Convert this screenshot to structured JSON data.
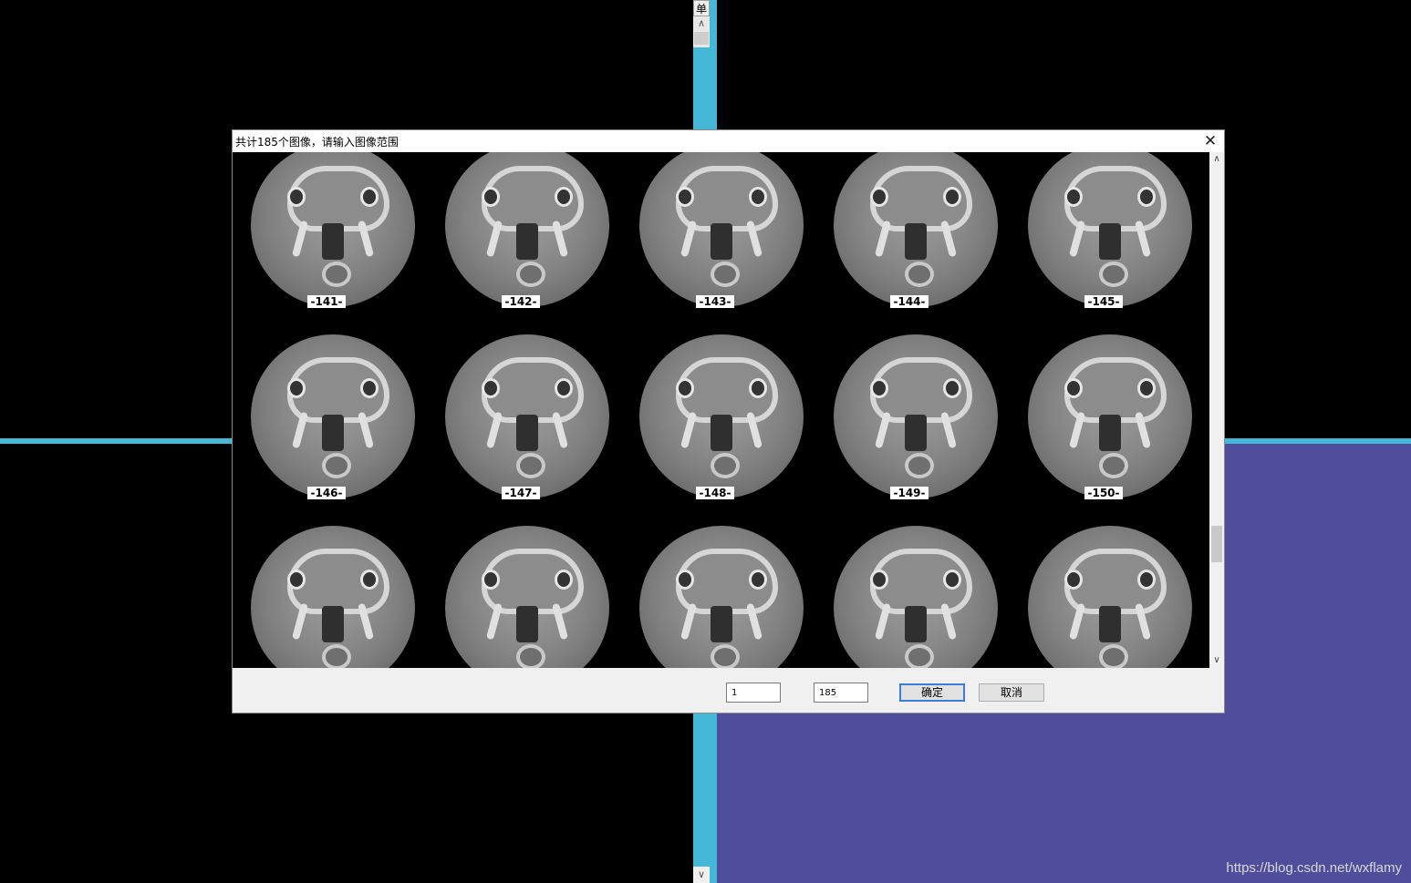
{
  "background": {
    "top_label": "单",
    "watermark": "https://blog.csdn.net/wxflamy",
    "colors": {
      "divider": "#45b8d8",
      "panel": "#4e4e9c"
    }
  },
  "dialog": {
    "title": "共计185个图像，请输入图像范围",
    "close_icon": "close-icon",
    "thumbnails": [
      {
        "label": "-141-"
      },
      {
        "label": "-142-"
      },
      {
        "label": "-143-"
      },
      {
        "label": "-144-"
      },
      {
        "label": "-145-"
      },
      {
        "label": "-146-"
      },
      {
        "label": "-147-"
      },
      {
        "label": "-148-"
      },
      {
        "label": "-149-"
      },
      {
        "label": "-150-"
      },
      {
        "label": ""
      },
      {
        "label": ""
      },
      {
        "label": ""
      },
      {
        "label": ""
      },
      {
        "label": ""
      }
    ],
    "range_from": "1",
    "range_to": "185",
    "ok_label": "确定",
    "cancel_label": "取消"
  }
}
